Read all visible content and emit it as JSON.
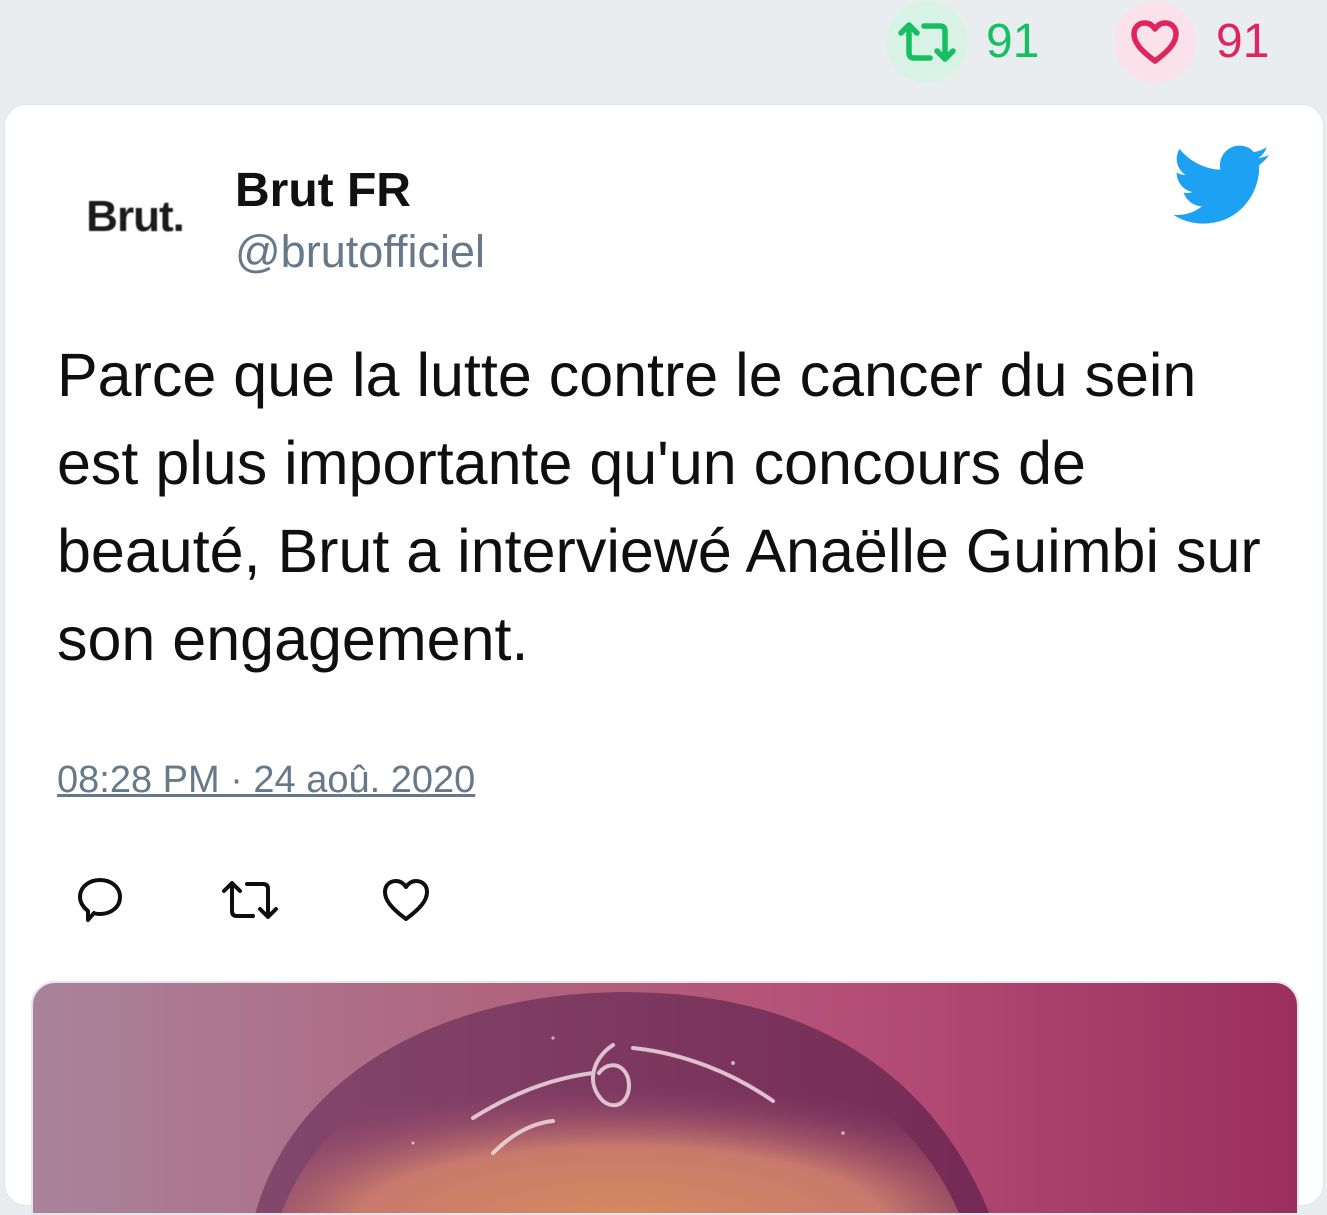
{
  "top_stats": {
    "retweets": "91",
    "likes": "91"
  },
  "tweet": {
    "avatar_text": "Brut.",
    "author_name": "Brut FR",
    "author_handle": "@brutofficiel",
    "text": "Parce que la lutte contre le cancer du sein est plus importante qu'un concours de beauté, Brut a interviewé Anaëlle Guimbi sur son engagement.",
    "timestamp": "08:28 PM · 24 aoû. 2020"
  },
  "icons": {
    "brand": "twitter-bird-icon",
    "reply": "reply-icon",
    "retweet": "retweet-icon",
    "like": "heart-icon"
  },
  "colors": {
    "retweet_green": "#17bf63",
    "like_red": "#e0245e",
    "twitter_blue": "#1da1f2",
    "secondary_text": "#66798a"
  }
}
